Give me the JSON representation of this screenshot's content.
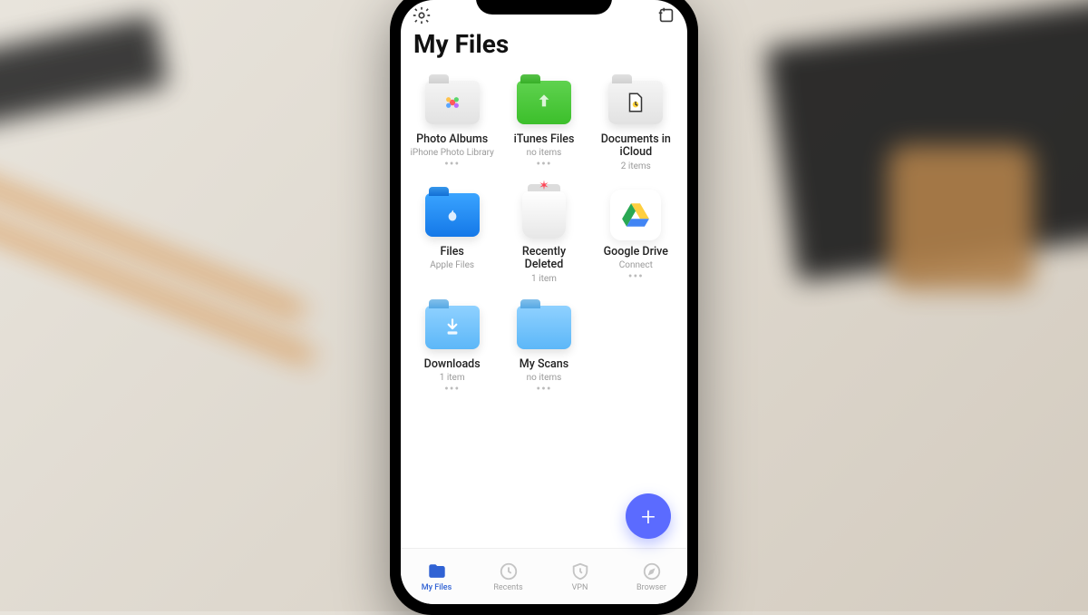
{
  "header": {
    "title": "My Files"
  },
  "items": [
    {
      "title": "Photo Albums",
      "subtitle": "iPhone Photo Library",
      "icon": "photos-folder",
      "has_more": true
    },
    {
      "title": "iTunes Files",
      "subtitle": "no items",
      "icon": "green-folder",
      "has_more": true
    },
    {
      "title": "Documents in iCloud",
      "subtitle": "2 items",
      "icon": "documents-folder",
      "has_more": false
    },
    {
      "title": "Files",
      "subtitle": "Apple Files",
      "icon": "blue-apple-folder",
      "has_more": false
    },
    {
      "title": "Recently Deleted",
      "subtitle": "1 item",
      "icon": "trash",
      "has_more": false
    },
    {
      "title": "Google Drive",
      "subtitle": "Connect",
      "icon": "google-drive",
      "has_more": true
    },
    {
      "title": "Downloads",
      "subtitle": "1 item",
      "icon": "downloads-folder",
      "has_more": true
    },
    {
      "title": "My Scans",
      "subtitle": "no items",
      "icon": "lightblue-folder",
      "has_more": true
    }
  ],
  "tabs": [
    {
      "label": "My Files",
      "icon": "folder-icon",
      "active": true
    },
    {
      "label": "Recents",
      "icon": "clock-icon",
      "active": false
    },
    {
      "label": "VPN",
      "icon": "shield-icon",
      "active": false
    },
    {
      "label": "Browser",
      "icon": "compass-icon",
      "active": false
    }
  ],
  "colors": {
    "accent": "#5b6bff",
    "tab_active": "#3062d4"
  }
}
